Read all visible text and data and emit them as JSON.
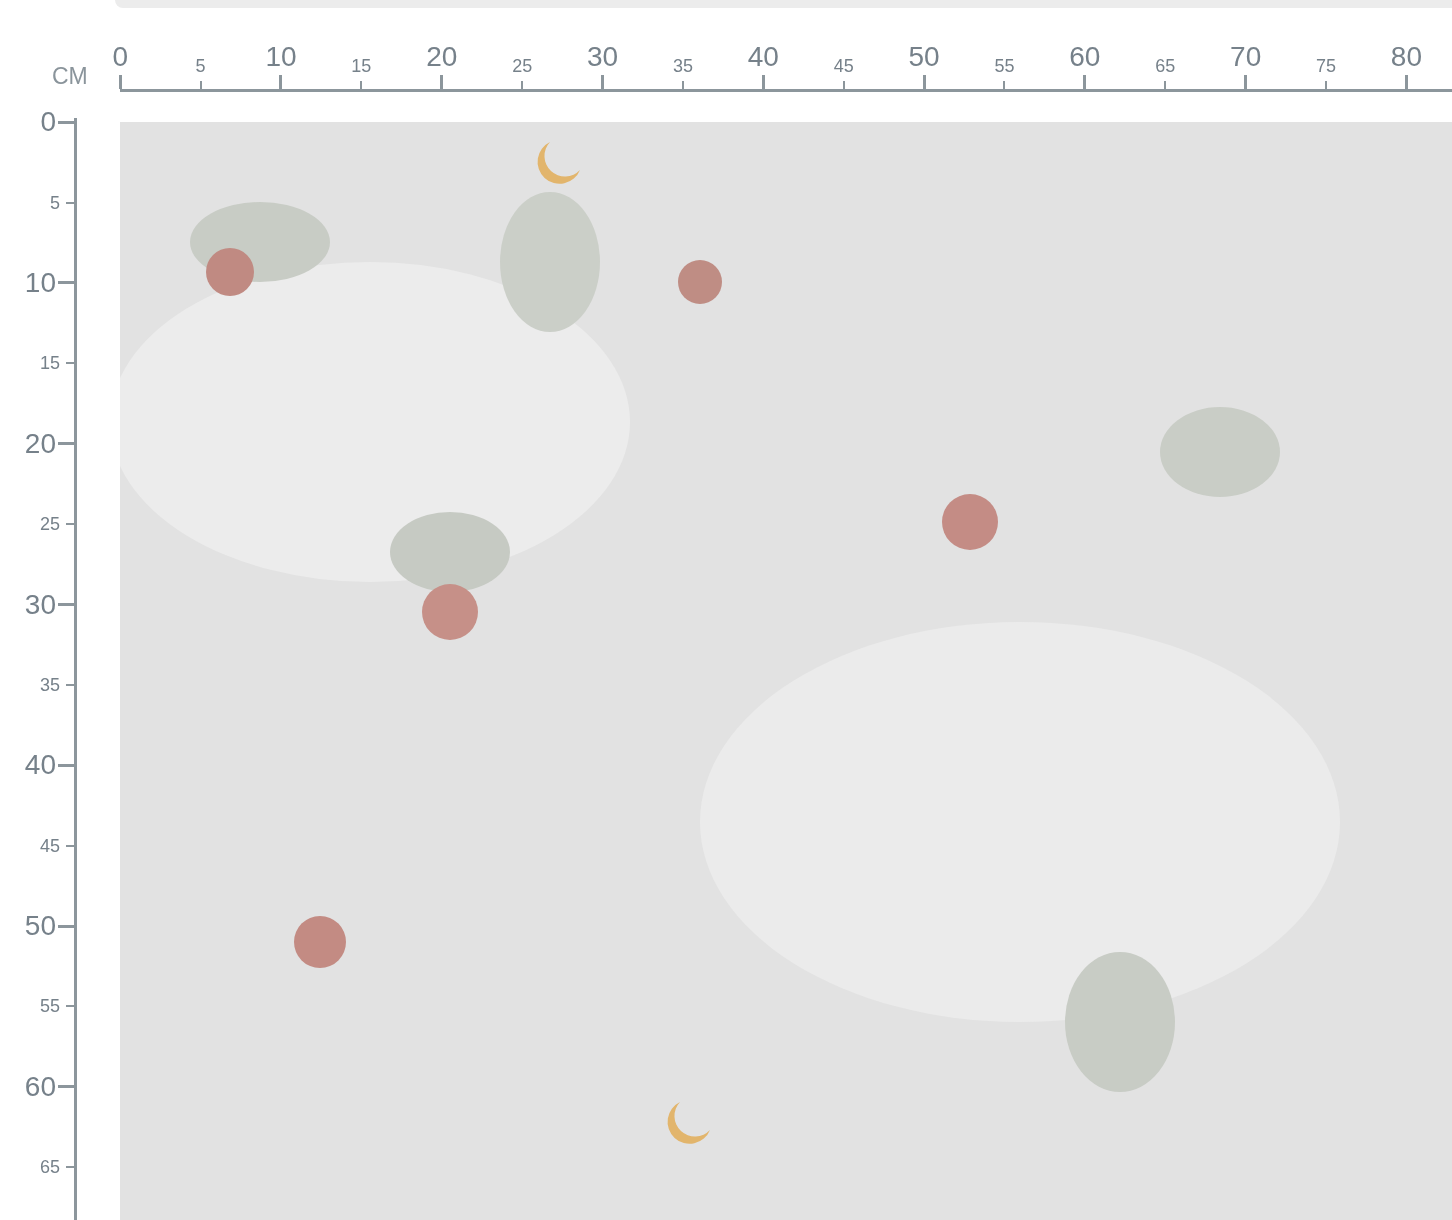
{
  "ruler_unit": "CM",
  "top_ruler": {
    "ticks": [
      {
        "label": "0",
        "kind": "major"
      },
      {
        "label": "5",
        "kind": "minor"
      },
      {
        "label": "10",
        "kind": "major"
      },
      {
        "label": "15",
        "kind": "minor"
      },
      {
        "label": "20",
        "kind": "major"
      },
      {
        "label": "25",
        "kind": "minor"
      },
      {
        "label": "30",
        "kind": "major"
      },
      {
        "label": "35",
        "kind": "minor"
      },
      {
        "label": "40",
        "kind": "major"
      },
      {
        "label": "45",
        "kind": "minor"
      },
      {
        "label": "50",
        "kind": "major"
      },
      {
        "label": "55",
        "kind": "minor"
      },
      {
        "label": "60",
        "kind": "major"
      },
      {
        "label": "65",
        "kind": "minor"
      },
      {
        "label": "70",
        "kind": "major"
      },
      {
        "label": "75",
        "kind": "minor"
      },
      {
        "label": "80",
        "kind": "major"
      }
    ]
  },
  "left_ruler": {
    "ticks": [
      {
        "label": "0",
        "kind": "major"
      },
      {
        "label": "5",
        "kind": "minor"
      },
      {
        "label": "10",
        "kind": "major"
      },
      {
        "label": "15",
        "kind": "minor"
      },
      {
        "label": "20",
        "kind": "major"
      },
      {
        "label": "25",
        "kind": "minor"
      },
      {
        "label": "30",
        "kind": "major"
      },
      {
        "label": "35",
        "kind": "minor"
      },
      {
        "label": "40",
        "kind": "major"
      },
      {
        "label": "45",
        "kind": "minor"
      },
      {
        "label": "50",
        "kind": "major"
      },
      {
        "label": "55",
        "kind": "minor"
      },
      {
        "label": "60",
        "kind": "major"
      },
      {
        "label": "65",
        "kind": "minor"
      }
    ]
  }
}
